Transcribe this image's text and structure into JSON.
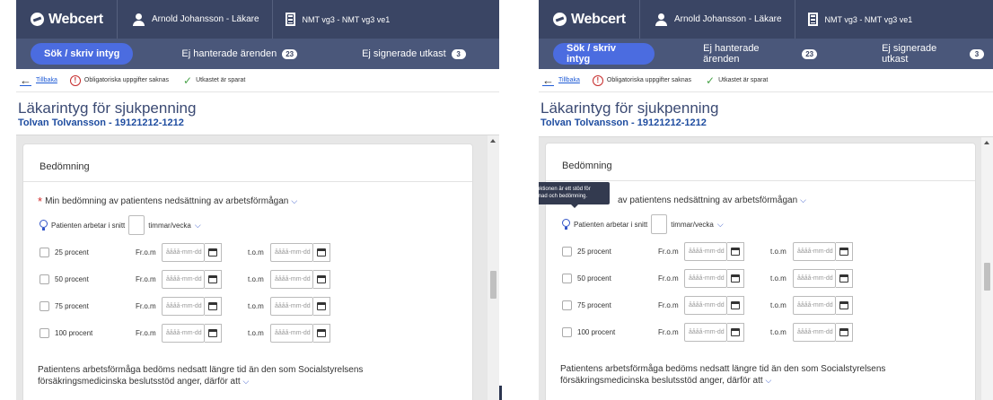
{
  "app": {
    "logo_text": "Webcert",
    "user": "Arnold Johansson - Läkare",
    "unit": "NMT vg3 - NMT vg3 ve1"
  },
  "nav": {
    "search": "Sök / skriv intyg",
    "unhandled": "Ej hanterade ärenden",
    "unhandled_count": "23",
    "unsigned": "Ej signerade utkast",
    "unsigned_count": "3"
  },
  "status": {
    "back": "Tillbaka",
    "missing": "Obligatoriska uppgifter saknas",
    "saved": "Utkastet är sparat"
  },
  "page": {
    "title": "Läkarintyg för sjukpenning",
    "patient": "Tolvan Tolvansson - 19121212-1212"
  },
  "form": {
    "section": "Bedömning",
    "question_left": "Min bedömning av patientens nedsättning av arbetsförmågan",
    "question_right_visible": "av patientens nedsättning av arbetsförmågan",
    "hours_label": "Patienten arbetar i snitt",
    "hours_unit": "timmar/vecka",
    "from_label": "Fr.o.m",
    "to_label": "t.o.m",
    "date_placeholder": "åååå-mm-dd",
    "rows": [
      {
        "label": "25 procent"
      },
      {
        "label": "50 procent"
      },
      {
        "label": "75 procent"
      },
      {
        "label": "100 procent"
      }
    ],
    "paragraph": "Patientens arbetsförmåga bedöms nedsatt längre tid än den som Socialstyrelsens försäkringsmedicinska beslutsstöd anger, därför att",
    "tooltip": "Funktionen är ett stöd för ifyllnad och bedömning."
  },
  "colors": {
    "topbar": "#3a4564",
    "navbar": "#4a577a",
    "active_tab": "#4b6ce0",
    "required": "#d12b2b",
    "link": "#1f5bd6"
  }
}
